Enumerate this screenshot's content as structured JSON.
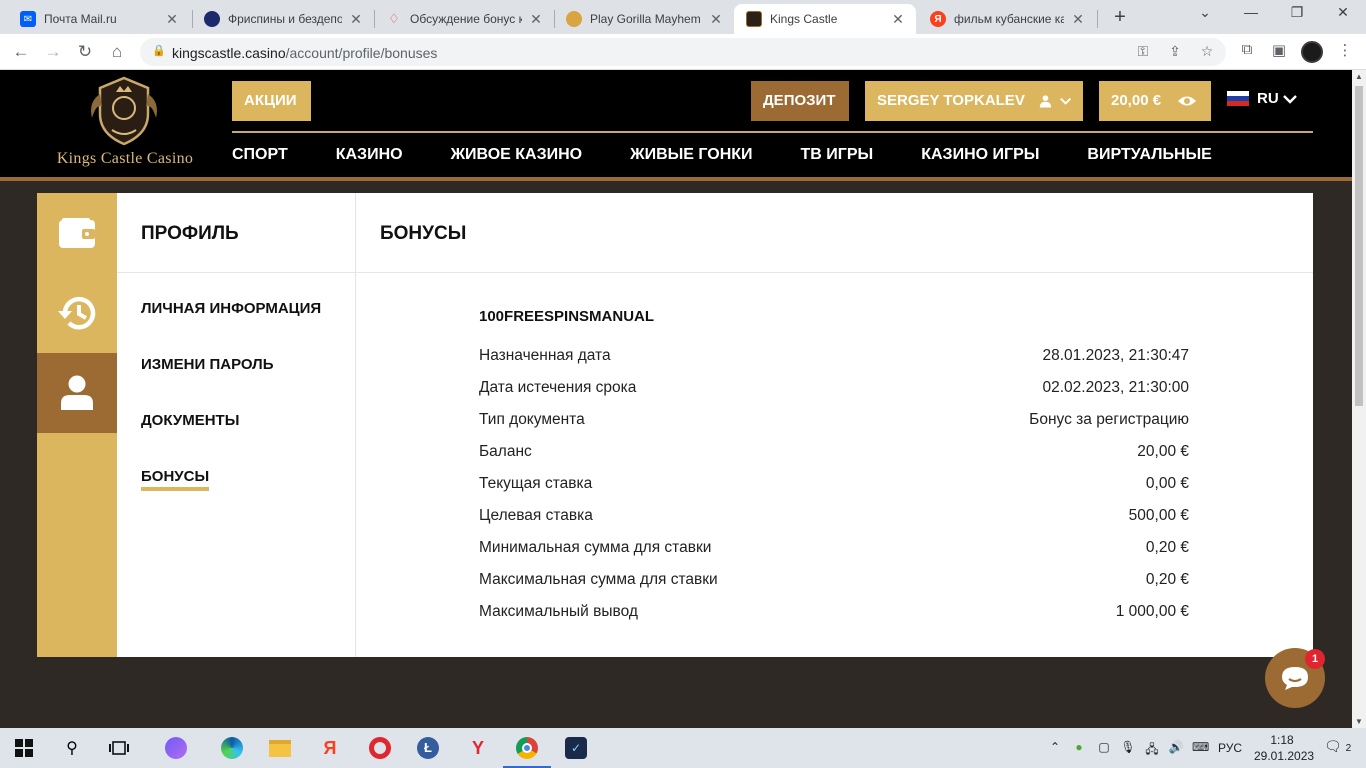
{
  "browser": {
    "tabs": [
      {
        "title": "Почта Mail.ru",
        "favicon_color": "#005ff9"
      },
      {
        "title": "Фриспины и бездепо",
        "favicon_color": "#1b2a6b"
      },
      {
        "title": "Обсуждение бонус к",
        "favicon_color": "#e0434b"
      },
      {
        "title": "Play Gorilla Mayhem -",
        "favicon_color": "#d9a441"
      },
      {
        "title": "Kings Castle",
        "favicon_color": "#2b2118"
      },
      {
        "title": "фильм кубанские каз",
        "favicon_color": "#fc3f1d"
      }
    ],
    "active_tab_index": 4,
    "url_host": "kingscastle.casino",
    "url_path": "/account/profile/bonuses"
  },
  "site": {
    "logo_text": "Kings Castle Casino",
    "promo_label": "АКЦИИ",
    "deposit_label": "ДЕПОЗИТ",
    "user_name": "SERGEY TOPKALEV",
    "balance": "20,00 €",
    "language": "RU",
    "nav": [
      "СПОРТ",
      "КАЗИНО",
      "ЖИВОЕ КАЗИНО",
      "ЖИВЫЕ ГОНКИ",
      "ТВ ИГРЫ",
      "КАЗИНО ИГРЫ",
      "ВИРТУАЛЬНЫЕ"
    ]
  },
  "profile": {
    "title": "ПРОФИЛЬ",
    "menu": [
      "ЛИЧНАЯ ИНФОРМАЦИЯ",
      "ИЗМЕНИ ПАРОЛЬ",
      "ДОКУМЕНТЫ",
      "БОНУСЫ"
    ],
    "active_menu_index": 3
  },
  "bonuses": {
    "title": "БОНУСЫ",
    "code": "100FREESPINSMANUAL",
    "rows": [
      {
        "label": "Назначенная дата",
        "value": "28.01.2023, 21:30:47"
      },
      {
        "label": "Дата истечения срока",
        "value": "02.02.2023, 21:30:00"
      },
      {
        "label": "Тип документа",
        "value": "Бонус за регистрацию"
      },
      {
        "label": "Баланс",
        "value": "20,00 €"
      },
      {
        "label": "Текущая ставка",
        "value": "0,00 €"
      },
      {
        "label": "Целевая ставка",
        "value": "500,00 €"
      },
      {
        "label": "Минимальная сумма для ставки",
        "value": "0,20 €"
      },
      {
        "label": "Максимальная сумма для ставки",
        "value": "0,20 €"
      },
      {
        "label": "Максимальный вывод",
        "value": "1 000,00 €"
      }
    ]
  },
  "chat": {
    "badge": "1"
  },
  "taskbar": {
    "lang": "РУС",
    "time": "1:18",
    "date": "29.01.2023",
    "notifications": "2"
  },
  "colors": {
    "gold": "#dcb65e",
    "brown": "#9c6a33",
    "page_bg": "#2f2925",
    "header_bg": "#000000"
  }
}
